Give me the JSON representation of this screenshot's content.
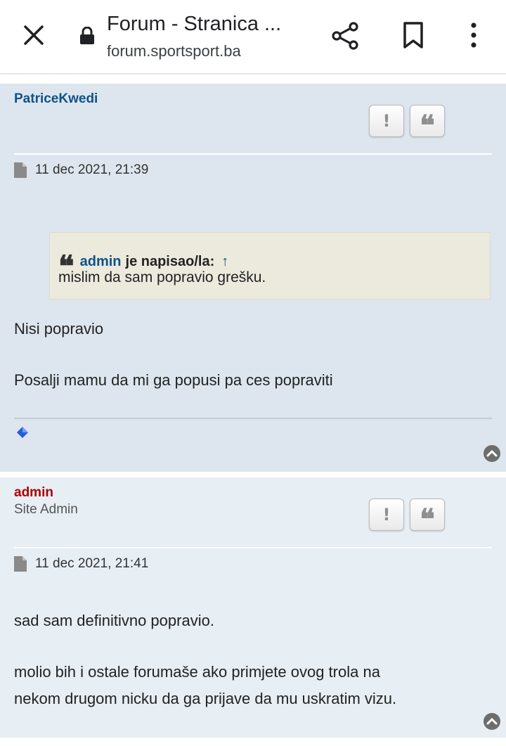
{
  "toolbar": {
    "title": "Forum - Stranica ...",
    "url": "forum.sportsport.ba"
  },
  "posts": [
    {
      "author": "PatriceKwedi",
      "datetime": "11 dec 2021, 21:39",
      "quote": {
        "user": "admin",
        "wrote": "je napisao/la:",
        "arrow": "↑",
        "text": "mislim da sam popravio grešku."
      },
      "lines": [
        "Nisi popravio",
        "Posalji mamu da mi ga popusi pa ces popraviti"
      ]
    },
    {
      "author": "admin",
      "rank": "Site Admin",
      "datetime": "11 dec 2021, 21:41",
      "lines": [
        "sad sam definitivno popravio.",
        "molio bih i ostale forumaše ako primjete ovog trola na",
        "nekom drugom nicku da ga prijave da mu uskratim vizu."
      ]
    }
  ],
  "buttons": {
    "report": "!",
    "quote": "❝"
  },
  "colors": {
    "post_bg_1": "#dde6ee",
    "post_bg_2": "#e7eef4",
    "username_blue": "#105289",
    "admin_red": "#aa0000",
    "quote_bg": "#ebeadd"
  }
}
